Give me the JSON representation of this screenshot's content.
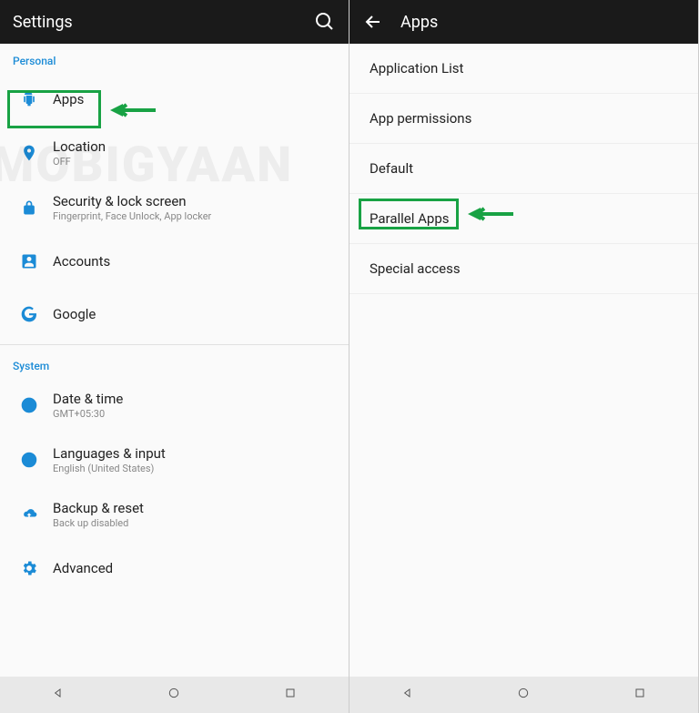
{
  "left": {
    "header": {
      "title": "Settings"
    },
    "sections": {
      "personal": {
        "label": "Personal",
        "items": {
          "apps": {
            "label": "Apps"
          },
          "location": {
            "label": "Location",
            "sub": "OFF"
          },
          "security": {
            "label": "Security & lock screen",
            "sub": "Fingerprint, Face Unlock, App locker"
          },
          "accounts": {
            "label": "Accounts"
          },
          "google": {
            "label": "Google"
          }
        }
      },
      "system": {
        "label": "System",
        "items": {
          "datetime": {
            "label": "Date & time",
            "sub": "GMT+05:30"
          },
          "languages": {
            "label": "Languages & input",
            "sub": "English (United States)"
          },
          "backup": {
            "label": "Backup & reset",
            "sub": "Back up disabled"
          },
          "advanced": {
            "label": "Advanced"
          }
        }
      }
    }
  },
  "right": {
    "header": {
      "title": "Apps"
    },
    "items": {
      "applist": "Application List",
      "permissions": "App permissions",
      "default": "Default",
      "parallel": "Parallel Apps",
      "special": "Special access"
    }
  },
  "watermark": "MOBIGYAAN",
  "highlight_color": "#18a244"
}
